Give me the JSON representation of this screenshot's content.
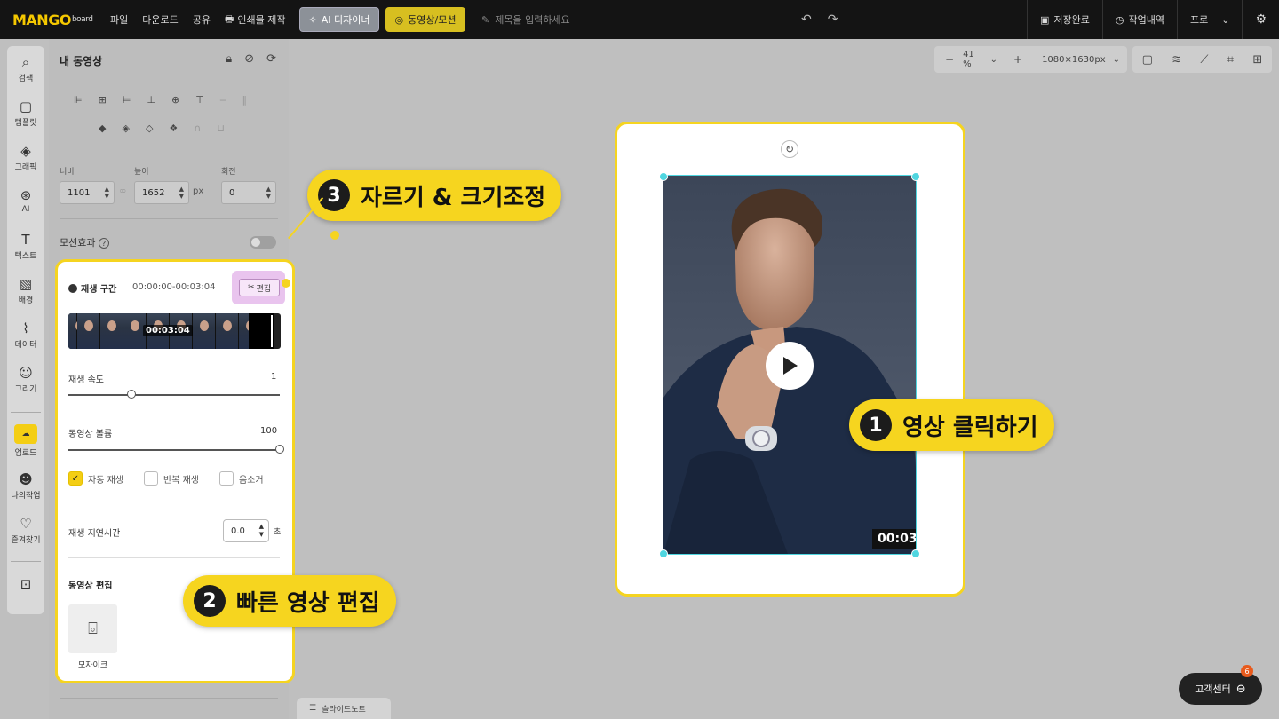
{
  "topbar": {
    "logo": "MANGO",
    "logo_sub": "board",
    "menu": [
      "파일",
      "다운로드",
      "공유",
      "인쇄물 제작"
    ],
    "ai_designer": "AI 디자이너",
    "video_motion": "동영상/모션",
    "title_placeholder": "제목을 입력하세요",
    "save_status": "저장완료",
    "history": "작업내역",
    "plan": "프로"
  },
  "leftnav": {
    "items": [
      {
        "label": "검색",
        "icon": "search-icon"
      },
      {
        "label": "템플릿",
        "icon": "template-icon"
      },
      {
        "label": "그래픽",
        "icon": "graphic-icon"
      },
      {
        "label": "AI",
        "icon": "ai-icon"
      },
      {
        "label": "텍스트",
        "icon": "text-icon"
      },
      {
        "label": "배경",
        "icon": "background-icon"
      },
      {
        "label": "데이터",
        "icon": "chart-icon"
      },
      {
        "label": "그리기",
        "icon": "draw-icon"
      },
      {
        "label": "업로드",
        "icon": "upload-icon"
      },
      {
        "label": "나의작업",
        "icon": "my-work-icon"
      },
      {
        "label": "즐겨찾기",
        "icon": "favorite-icon"
      }
    ]
  },
  "panel": {
    "title": "내 동영상",
    "width_label": "너비",
    "width_value": "1101",
    "height_label": "높이",
    "height_value": "1652",
    "unit": "px",
    "rotate_label": "회전",
    "rotate_value": "0",
    "motion_label": "모션효과",
    "play_range_label": "재생 구간",
    "play_range_value": "00:00:00-00:03:04",
    "edit_button": "편집",
    "strip_time": "00:03:04",
    "speed_label": "재생 속도",
    "speed_value": "1",
    "speed_fraction": 0.3,
    "volume_label": "동영상 볼륨",
    "volume_value": "100",
    "volume_fraction": 1.0,
    "autoplay": "자동 재생",
    "autoplay_checked": true,
    "loop": "반복 재생",
    "mute": "음소거",
    "delay_label": "재생 지연시간",
    "delay_value": "0.0",
    "delay_unit": "초",
    "video_edit_title": "동영상 편집",
    "mosaic_label": "모자이크"
  },
  "canvas": {
    "zoom": "41 %",
    "size": "1080×1630px",
    "video_time": "00:03"
  },
  "callouts": {
    "c1_num": "1",
    "c1_text": "영상 클릭하기",
    "c2_num": "2",
    "c2_text": "빠른 영상 편집",
    "c3_num": "3",
    "c3_text": "자르기 & 크기조정"
  },
  "bottom": {
    "slide_note": "슬라이드노트",
    "support": "고객센터",
    "support_badge": "6"
  },
  "colors": {
    "accent_yellow": "#f5d420",
    "selection_cyan": "#4fd6e0",
    "edit_pink": "#e9c4ee"
  }
}
